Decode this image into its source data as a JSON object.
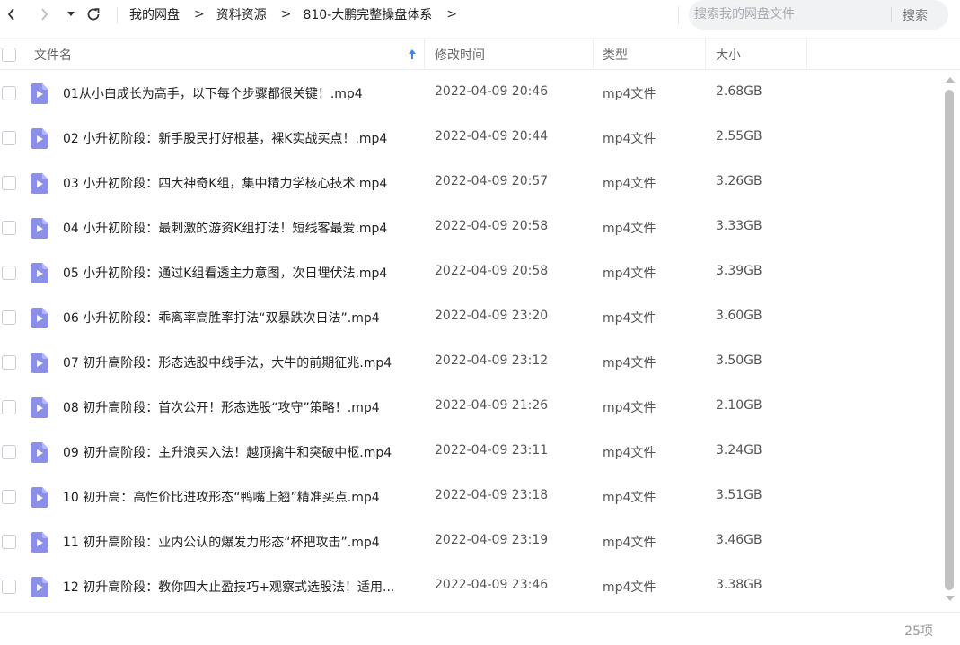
{
  "nav": {
    "back_icon": "chevron-left-icon",
    "forward_icon": "chevron-right-icon",
    "history_icon": "caret-down-icon",
    "refresh_icon": "refresh-icon"
  },
  "breadcrumb": [
    "我的网盘",
    "资料资源",
    "810-大鹏完整操盘体系"
  ],
  "breadcrumb_separator": ">",
  "search": {
    "placeholder": "搜索我的网盘文件",
    "button_label": "搜索"
  },
  "columns": {
    "name": "文件名",
    "modified": "修改时间",
    "type": "类型",
    "size": "大小",
    "sort_icon": "arrow-up-icon"
  },
  "files": [
    {
      "name": "01从小白成长为高手，以下每个步骤都很关键！.mp4",
      "modified": "2022-04-09 20:46",
      "type": "mp4文件",
      "size": "2.68GB"
    },
    {
      "name": "02 小升初阶段：新手股民打好根基，裸K实战买点！.mp4",
      "modified": "2022-04-09 20:44",
      "type": "mp4文件",
      "size": "2.55GB"
    },
    {
      "name": "03 小升初阶段：四大神奇K组，集中精力学核心技术.mp4",
      "modified": "2022-04-09 20:57",
      "type": "mp4文件",
      "size": "3.26GB"
    },
    {
      "name": "04 小升初阶段：最刺激的游资K组打法！短线客最爱.mp4",
      "modified": "2022-04-09 20:58",
      "type": "mp4文件",
      "size": "3.33GB"
    },
    {
      "name": "05 小升初阶段：通过K组看透主力意图，次日埋伏法.mp4",
      "modified": "2022-04-09 20:58",
      "type": "mp4文件",
      "size": "3.39GB"
    },
    {
      "name": "06 小升初阶段：乖离率高胜率打法“双暴跌次日法”.mp4",
      "modified": "2022-04-09 23:20",
      "type": "mp4文件",
      "size": "3.60GB"
    },
    {
      "name": "07 初升高阶段：形态选股中线手法，大牛的前期征兆.mp4",
      "modified": "2022-04-09 23:12",
      "type": "mp4文件",
      "size": "3.50GB"
    },
    {
      "name": "08 初升高阶段：首次公开！形态选股“攻守”策略！.mp4",
      "modified": "2022-04-09 21:26",
      "type": "mp4文件",
      "size": "2.10GB"
    },
    {
      "name": "09 初升高阶段：主升浪买入法！越顶擒牛和突破中枢.mp4",
      "modified": "2022-04-09 23:11",
      "type": "mp4文件",
      "size": "3.24GB"
    },
    {
      "name": "10 初升高：高性价比进攻形态“鸭嘴上翘”精准买点.mp4",
      "modified": "2022-04-09 23:18",
      "type": "mp4文件",
      "size": "3.51GB"
    },
    {
      "name": "11 初升高阶段：业内公认的爆发力形态“杯把攻击”.mp4",
      "modified": "2022-04-09 23:19",
      "type": "mp4文件",
      "size": "3.46GB"
    },
    {
      "name": "12 初升高阶段：教你四大止盈技巧+观察式选股法！适用...",
      "modified": "2022-04-09 23:46",
      "type": "mp4文件",
      "size": "3.38GB"
    }
  ],
  "file_icon": "video-file-icon",
  "footer": {
    "count": "25项"
  },
  "colors": {
    "file_icon": "#8b8fe8",
    "accent": "#3b82f6",
    "search_bg": "#f1f2f4"
  }
}
